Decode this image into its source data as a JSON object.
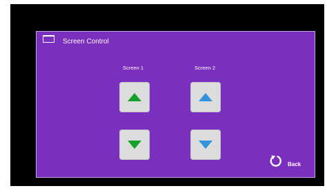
{
  "header": {
    "title": "Screen Control",
    "icon": "screen-icon"
  },
  "columns": [
    {
      "label": "Screen 1"
    },
    {
      "label": "Screen 2"
    }
  ],
  "buttons": {
    "screen1_up": {
      "icon": "arrow-up-icon",
      "color": "#13a12a"
    },
    "screen2_up": {
      "icon": "arrow-up-icon",
      "color": "#2f93e0"
    },
    "screen1_down": {
      "icon": "arrow-down-icon",
      "color": "#13a12a"
    },
    "screen2_down": {
      "icon": "arrow-down-icon",
      "color": "#2f93e0"
    }
  },
  "footer": {
    "back_label": "Back",
    "back_icon": "refresh-icon"
  },
  "colors": {
    "panel_background": "#7b2fbe",
    "bezel": "#000000",
    "button_background": "#dcdcdc",
    "text": "#ffffff"
  }
}
